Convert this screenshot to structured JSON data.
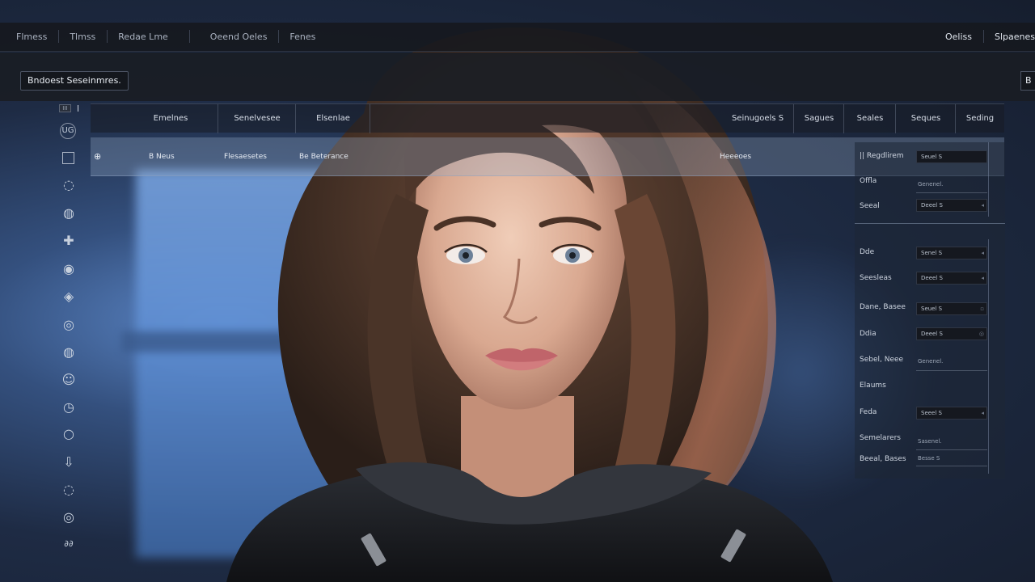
{
  "menubar": {
    "left_items": [
      "Flmess",
      "Tlmss",
      "Redae Lme",
      "Oeend Oeles",
      "Fenes"
    ],
    "right_items": [
      "Oeliss",
      "Slpaenes"
    ]
  },
  "toolbar": {
    "primary_button": "Bndoest Seseinmres.",
    "edge_button": "B"
  },
  "rail": {
    "top_mini_label": "III",
    "icons": [
      "circle-icon",
      "cube-icon",
      "crosshair-icon",
      "globe-icon",
      "grid-icon",
      "sphere-icon",
      "settings-icon",
      "person-icon",
      "timer-icon",
      "ring-icon",
      "download-icon",
      "record-icon",
      "world-icon",
      "group-icon"
    ],
    "icon_glyphs": [
      "UG",
      "◌",
      "◍",
      "✚",
      "◉",
      "◈",
      "◎",
      "◍",
      "☺",
      "◷",
      "○",
      "⇩",
      "◌",
      "◎",
      "∂∂"
    ]
  },
  "table": {
    "columns": [
      "Emelnes",
      "Senelvesee",
      "Elsenlae",
      "Seinugoels S",
      "Sagues",
      "Seales",
      "Seques",
      "Seding"
    ],
    "selected_row": {
      "icon": "⊕",
      "cells": [
        "B Neus",
        "Flesaesetes",
        "Be Beterance",
        "Heeeoes"
      ]
    }
  },
  "panel": {
    "props": [
      {
        "label": "|| Regdlirem",
        "field": "Seuel S",
        "kind": "field"
      },
      {
        "label": "Offla",
        "field": "Genenel.",
        "kind": "plain"
      },
      {
        "label": "Seeal",
        "field": "Deeel S",
        "kind": "field"
      },
      {
        "label": "Dde",
        "field": "Senel S",
        "kind": "field"
      },
      {
        "label": "Seesleas",
        "field": "Deeel S",
        "kind": "field"
      },
      {
        "label": "Dane, Basee",
        "field": "Seuel S",
        "kind": "field"
      },
      {
        "label": "Ddia",
        "field": "Deeel S",
        "kind": "field"
      },
      {
        "label": "Sebel, Neee",
        "field": "Genenel.",
        "kind": "plain"
      },
      {
        "label": "Elaums",
        "field": "",
        "kind": "empty"
      },
      {
        "label": "Feda",
        "field": "Seeel S",
        "kind": "field"
      },
      {
        "label": "Semelarers",
        "field": "Sasenel.",
        "kind": "plain"
      },
      {
        "label": "Beeal, Bases",
        "field": "Besse S",
        "kind": "plain"
      }
    ]
  },
  "colors": {
    "menubar_bg": "#16181e",
    "accent_blue": "#5e8ed3",
    "selected_row": "#96aac8"
  }
}
